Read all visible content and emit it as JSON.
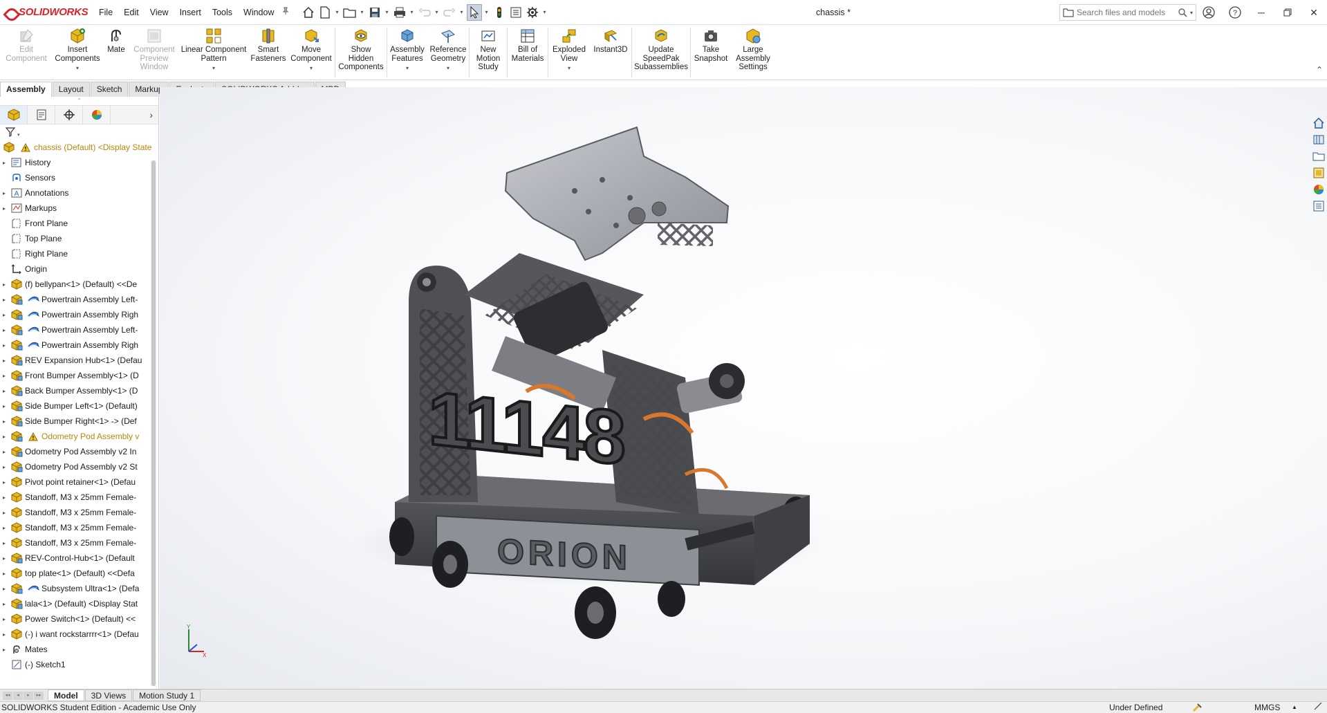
{
  "app": {
    "brand": "SOLIDWORKS",
    "document_title": "chassis *"
  },
  "menu": [
    "File",
    "Edit",
    "View",
    "Insert",
    "Tools",
    "Window"
  ],
  "search": {
    "placeholder": "Search files and models"
  },
  "ribbon": {
    "commands": [
      {
        "label": "Edit\nComponent",
        "enabled": false,
        "icon": "edit-component-icon"
      },
      {
        "label": "Insert\nComponents",
        "enabled": true,
        "icon": "insert-components-icon",
        "dropdown": true
      },
      {
        "label": "Mate",
        "enabled": true,
        "icon": "mate-icon"
      },
      {
        "label": "Component\nPreview\nWindow",
        "enabled": false,
        "icon": "component-preview-icon"
      },
      {
        "label": "Linear Component\nPattern",
        "enabled": true,
        "icon": "linear-pattern-icon",
        "dropdown": true
      },
      {
        "label": "Smart\nFasteners",
        "enabled": true,
        "icon": "smart-fasteners-icon"
      },
      {
        "label": "Move\nComponent",
        "enabled": true,
        "icon": "move-component-icon",
        "dropdown": true
      },
      {
        "label": "Show\nHidden\nComponents",
        "enabled": true,
        "icon": "show-hidden-icon"
      },
      {
        "label": "Assembly\nFeatures",
        "enabled": true,
        "icon": "assembly-features-icon",
        "dropdown": true
      },
      {
        "label": "Reference\nGeometry",
        "enabled": true,
        "icon": "reference-geometry-icon",
        "dropdown": true
      },
      {
        "label": "New\nMotion\nStudy",
        "enabled": true,
        "icon": "motion-study-icon"
      },
      {
        "label": "Bill of\nMaterials",
        "enabled": true,
        "icon": "bom-icon"
      },
      {
        "label": "Exploded\nView",
        "enabled": true,
        "icon": "exploded-view-icon",
        "dropdown": true
      },
      {
        "label": "Instant3D",
        "enabled": true,
        "icon": "instant3d-icon"
      },
      {
        "label": "Update\nSpeedPak\nSubassemblies",
        "enabled": true,
        "icon": "speedpak-icon"
      },
      {
        "label": "Take\nSnapshot",
        "enabled": true,
        "icon": "snapshot-icon"
      },
      {
        "label": "Large\nAssembly\nSettings",
        "enabled": true,
        "icon": "large-assembly-icon"
      }
    ]
  },
  "tabs": [
    "Assembly",
    "Layout",
    "Sketch",
    "Markup",
    "Evaluate",
    "SOLIDWORKS Add-Ins",
    "MBD"
  ],
  "active_tab": "Assembly",
  "tree": {
    "root": "chassis (Default) <Display State",
    "items": [
      {
        "label": "History",
        "icon": "history-icon",
        "expandable": true
      },
      {
        "label": "Sensors",
        "icon": "sensors-icon",
        "expandable": false
      },
      {
        "label": "Annotations",
        "icon": "annotations-icon",
        "expandable": true
      },
      {
        "label": "Markups",
        "icon": "markups-icon",
        "expandable": true
      },
      {
        "label": "Front Plane",
        "icon": "plane-icon",
        "expandable": false
      },
      {
        "label": "Top Plane",
        "icon": "plane-icon",
        "expandable": false
      },
      {
        "label": "Right Plane",
        "icon": "plane-icon",
        "expandable": false
      },
      {
        "label": "Origin",
        "icon": "origin-icon",
        "expandable": false
      },
      {
        "label": "(f) bellypan<1> (Default) <<De",
        "icon": "part-icon",
        "expandable": true
      },
      {
        "label": "Powertrain Assembly Left-",
        "icon": "subassembly-icon",
        "expandable": true,
        "speedpak": true
      },
      {
        "label": "Powertrain Assembly Righ",
        "icon": "subassembly-icon",
        "expandable": true,
        "speedpak": true
      },
      {
        "label": "Powertrain Assembly Left-",
        "icon": "subassembly-icon",
        "expandable": true,
        "speedpak": true
      },
      {
        "label": "Powertrain Assembly Righ",
        "icon": "subassembly-icon",
        "expandable": true,
        "speedpak": true
      },
      {
        "label": "REV Expansion Hub<1> (Defau",
        "icon": "subassembly-icon",
        "expandable": true
      },
      {
        "label": "Front Bumper Assembly<1> (D",
        "icon": "subassembly-icon",
        "expandable": true
      },
      {
        "label": "Back Bumper Assembly<1> (D",
        "icon": "subassembly-icon",
        "expandable": true
      },
      {
        "label": "Side Bumper Left<1> (Default)",
        "icon": "subassembly-icon",
        "expandable": true
      },
      {
        "label": "Side Bumper Right<1> -> (Def",
        "icon": "subassembly-icon",
        "expandable": true
      },
      {
        "label": "Odometry Pod Assembly v",
        "icon": "subassembly-icon",
        "expandable": true,
        "warning": true
      },
      {
        "label": "Odometry Pod Assembly v2 In",
        "icon": "subassembly-icon",
        "expandable": true
      },
      {
        "label": "Odometry Pod Assembly v2 St",
        "icon": "subassembly-icon",
        "expandable": true
      },
      {
        "label": "Pivot point retainer<1> (Defau",
        "icon": "part-icon",
        "expandable": true
      },
      {
        "label": "Standoff, M3 x 25mm Female-",
        "icon": "part-icon",
        "expandable": true
      },
      {
        "label": "Standoff, M3 x 25mm Female-",
        "icon": "part-icon",
        "expandable": true
      },
      {
        "label": "Standoff, M3 x 25mm Female-",
        "icon": "part-icon",
        "expandable": true
      },
      {
        "label": "Standoff, M3 x 25mm Female-",
        "icon": "part-icon",
        "expandable": true
      },
      {
        "label": "REV-Control-Hub<1> (Default",
        "icon": "subassembly-icon",
        "expandable": true
      },
      {
        "label": "top plate<1> (Default) <<Defa",
        "icon": "part-icon",
        "expandable": true
      },
      {
        "label": "Subsystem Ultra<1> (Defa",
        "icon": "subassembly-icon",
        "expandable": true,
        "speedpak": true
      },
      {
        "label": "lala<1> (Default) <Display Stat",
        "icon": "subassembly-icon",
        "expandable": true
      },
      {
        "label": "Power Switch<1> (Default) <<",
        "icon": "part-icon",
        "expandable": true
      },
      {
        "label": "(-) i want rockstarrrr<1> (Defau",
        "icon": "part-icon",
        "expandable": true
      },
      {
        "label": "Mates",
        "icon": "mates-icon",
        "expandable": true
      },
      {
        "label": "(-) Sketch1",
        "icon": "sketch-icon",
        "expandable": false
      }
    ]
  },
  "model": {
    "number_plate": "11148",
    "team_plate": "ORION"
  },
  "triad": {
    "y_label": "Y",
    "x_label": "X"
  },
  "bottom_tabs": [
    "Model",
    "3D Views",
    "Motion Study 1"
  ],
  "active_bottom_tab": "Model",
  "status": {
    "edition": "SOLIDWORKS Student Edition - Academic Use Only",
    "definition": "Under Defined",
    "units": "MMGS"
  },
  "colors": {
    "brand_red": "#d8232a",
    "warning_text": "#b8860b",
    "assembly_yellow": "#e8b820",
    "plate_silver": "#a3a6ad",
    "frame_dark": "#4a4c50",
    "accent_orange": "#d9782d"
  }
}
